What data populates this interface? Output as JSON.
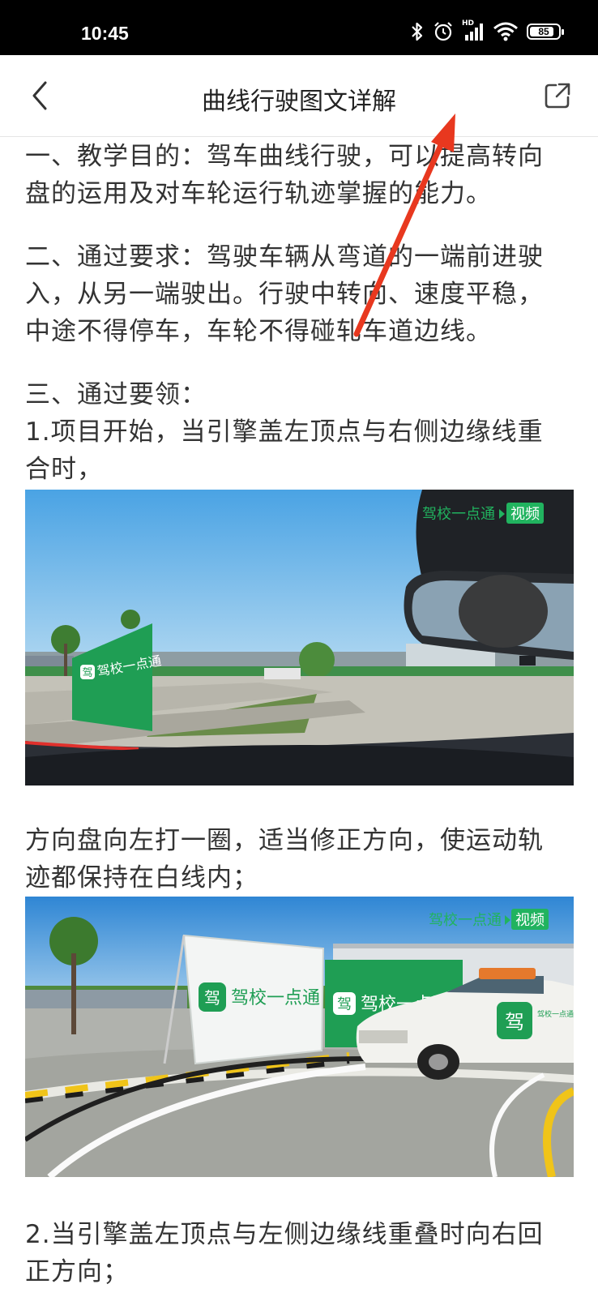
{
  "status_bar": {
    "time": "10:45",
    "icons": [
      "bluetooth-icon",
      "alarm-icon",
      "hd-signal-icon",
      "wifi-icon",
      "battery-icon"
    ],
    "hd_label": "HD",
    "battery": "85",
    "battery_level": 0.85
  },
  "header": {
    "title": "曲线行驶图文详解",
    "back_icon": "back-arrow-icon",
    "share_icon": "share-icon"
  },
  "article": {
    "p1": "一、教学目的：驾车曲线行驶，可以提高转向\n盘的运用及对车轮运行轨迹掌握的能力。",
    "p2": "二、通过要求：驾驶车辆从弯道的一端前进驶\n入，从另一端驶出。行驶中转向、速度平稳，\n中途不得停车，车轮不得碰轧车道边线。",
    "p3": "三、通过要领：\n1.项目开始，当引擎盖左顶点与右侧边缘线重\n合时，",
    "p4": "方向盘向左打一圈，适当修正方向，使运动轨\n迹都保持在白线内；",
    "p5": "2.当引擎盖左顶点与左侧边缘线重叠时向右回\n正方向；",
    "image1": {
      "watermark_brand": "驾校一点通",
      "watermark_tag": "视频",
      "sign_text": "驾校一点通",
      "sign_logo_char": "驾"
    },
    "image2": {
      "watermark_brand": "驾校一点通",
      "watermark_tag": "视频",
      "sign1_text": "驾校一点通",
      "sign2_text": "驾校一点通",
      "logo_char": "驾",
      "car_text": "驾校一点通"
    }
  },
  "colors": {
    "status_bar_bg": "#000000",
    "annotation_arrow": "#e8381f",
    "brand_green": "#1fab5e"
  }
}
